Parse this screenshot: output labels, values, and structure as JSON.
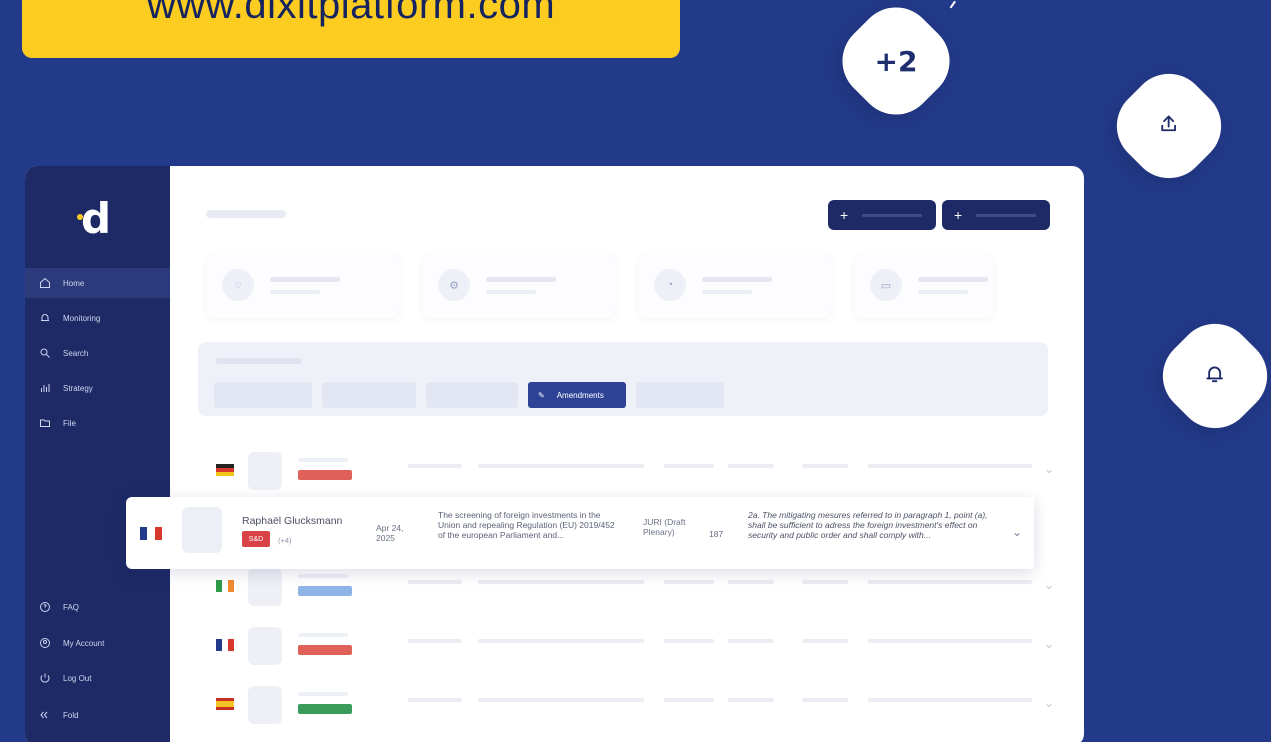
{
  "banner": {
    "url": "www.dixitplatform.com"
  },
  "floating": {
    "count_badge": "+2",
    "share_icon": "share-upload-icon",
    "bell_icon": "bell-icon"
  },
  "sidebar": {
    "logo": "d",
    "items": [
      {
        "label": "Home",
        "icon": "home-icon"
      },
      {
        "label": "Monitoring",
        "icon": "bell-icon"
      },
      {
        "label": "Search",
        "icon": "search-icon"
      },
      {
        "label": "Strategy",
        "icon": "bar-chart-icon"
      },
      {
        "label": "File",
        "icon": "folder-icon"
      }
    ],
    "bottom_items": [
      {
        "label": "FAQ",
        "icon": "help-icon"
      },
      {
        "label": "My Account",
        "icon": "account-icon"
      },
      {
        "label": "Log Out",
        "icon": "power-icon"
      },
      {
        "label": "Fold",
        "icon": "fold-icon"
      }
    ]
  },
  "filters": {
    "active_chip": "Amendments"
  },
  "highlighted_row": {
    "member": "Raphaël Glucksmann",
    "party": "S&D",
    "count": "(+4)",
    "date": "Apr 24, 2025",
    "title": "The screening of foreign investments in the Union and repealing Regulation (EU) 2019/452 of the european Parliament and...",
    "committee": "JURI (Draft Plenary)",
    "number": "187",
    "text": "2a. The mitigating mesures referred to in paragraph 1, point (a), shall be sufficient to adress the foreign investment's effect on security and public order and shall comply with..."
  },
  "colors": {
    "background": "#233a8a",
    "banner": "#fccd20",
    "sidebar": "#1d2a66",
    "accent": "#2f4396"
  }
}
